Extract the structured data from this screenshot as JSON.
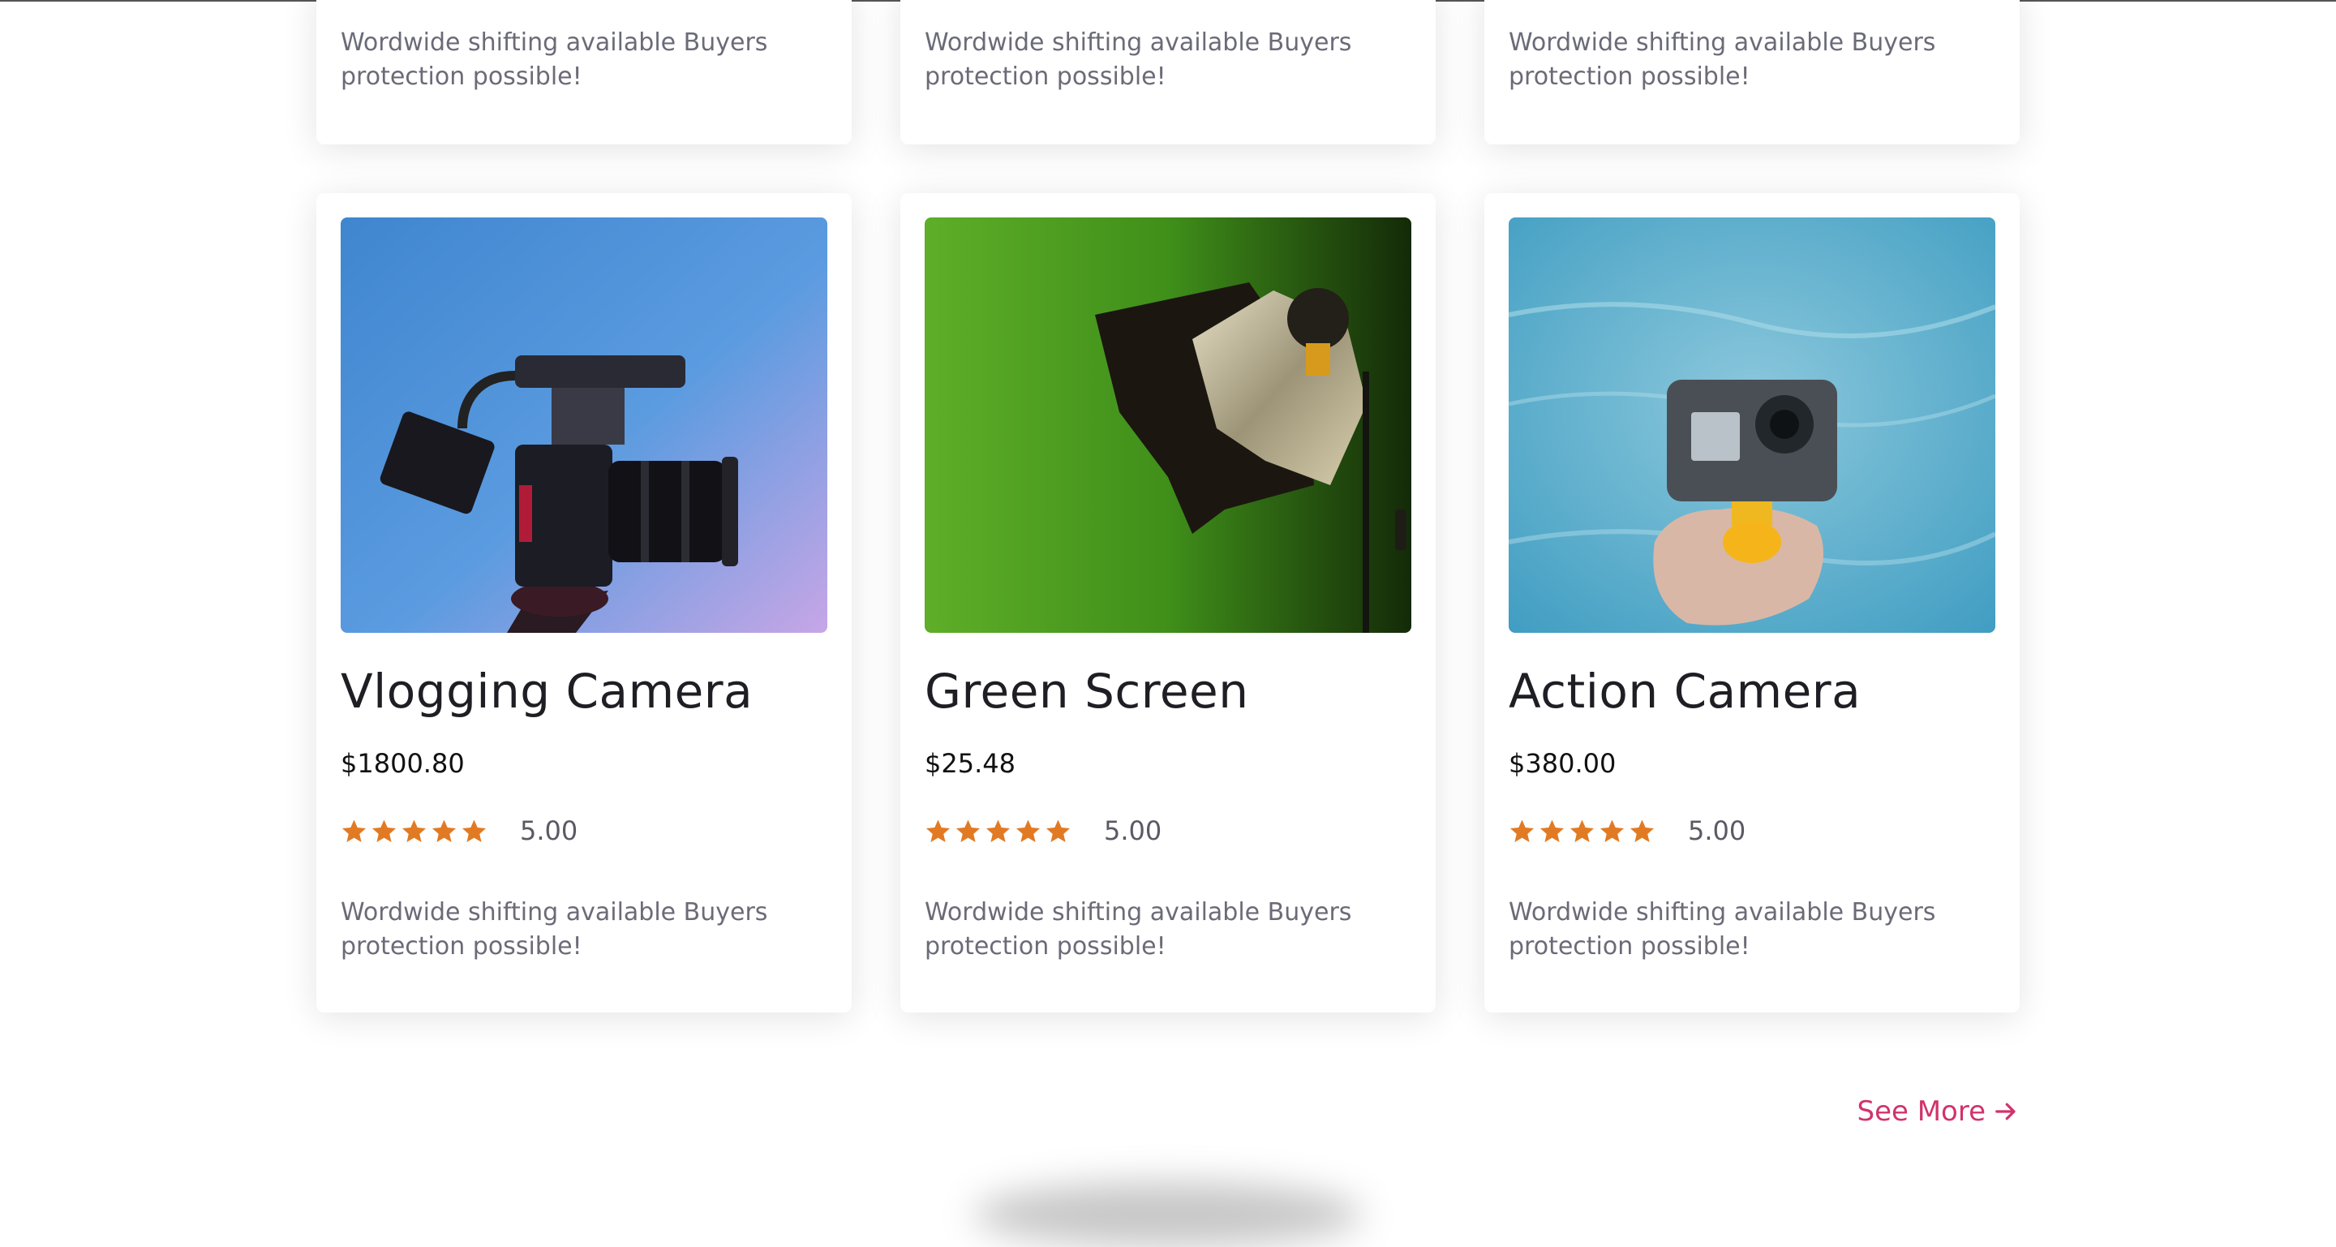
{
  "colors": {
    "accent": "#d1336b",
    "star": "#e17a23",
    "title_text": "#1e1e24",
    "description_text": "#6b6b78"
  },
  "top_cards": [
    {
      "description": "Wordwide shifting available Buyers protection possible!"
    },
    {
      "description": "Wordwide shifting available Buyers protection possible!"
    },
    {
      "description": "Wordwide shifting available Buyers protection possible!"
    }
  ],
  "products": [
    {
      "image": "vlogging-camera-photo",
      "title": "Vlogging Camera",
      "price": "$1800.80",
      "stars": 5,
      "rating": "5.00",
      "description": "Wordwide shifting available Buyers protection possible!"
    },
    {
      "image": "green-screen-photo",
      "title": "Green Screen",
      "price": "$25.48",
      "stars": 5,
      "rating": "5.00",
      "description": "Wordwide shifting available Buyers protection possible!"
    },
    {
      "image": "action-camera-photo",
      "title": "Action Camera",
      "price": "$380.00",
      "stars": 5,
      "rating": "5.00",
      "description": "Wordwide shifting available Buyers protection possible!"
    }
  ],
  "see_more": {
    "label": "See More",
    "icon": "arrow-right-icon"
  }
}
